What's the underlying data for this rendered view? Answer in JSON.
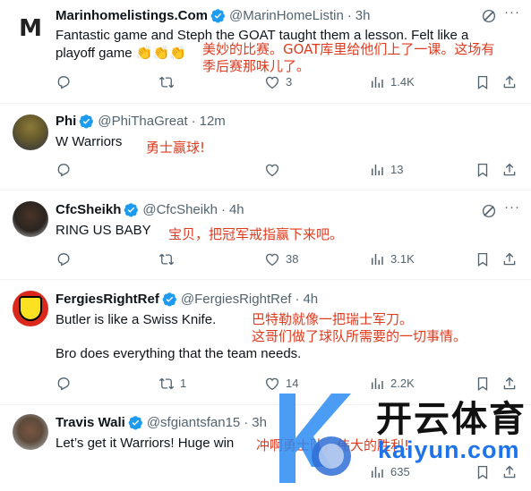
{
  "tweets": [
    {
      "name": "Marinhomelistings.Com",
      "handle": "@MarinHomeListin",
      "time": "3h",
      "body_lines": [
        "Fantastic game and Steph the GOAT taught them a lesson. Felt like a",
        "playoff game 👏👏👏"
      ],
      "annotation_lines": [
        "美妙的比赛。GOAT库里给他们上了一课。这场有",
        "季后赛那味儿了。"
      ],
      "replies": "",
      "retweets": "",
      "likes": "3",
      "views": "1.4K",
      "avatar_letter": "M"
    },
    {
      "name": "Phi",
      "handle": "@PhiThaGreat",
      "time": "12m",
      "body_lines": [
        "W Warriors"
      ],
      "annotation_lines": [
        "勇士赢球!"
      ],
      "replies": "",
      "retweets": "",
      "likes": "",
      "views": "13"
    },
    {
      "name": "CfcSheikh",
      "handle": "@CfcSheikh",
      "time": "4h",
      "body_lines": [
        "RING US BABY"
      ],
      "annotation_lines": [
        "宝贝，把冠军戒指赢下来吧。"
      ],
      "replies": "",
      "retweets": "",
      "likes": "38",
      "views": "3.1K"
    },
    {
      "name": "FergiesRightRef",
      "handle": "@FergiesRightRef",
      "time": "4h",
      "body_lines": [
        "Butler is like a Swiss Knife.",
        "",
        "Bro does everything that the team needs."
      ],
      "annotation_lines": [
        "巴特勒就像一把瑞士军刀。",
        "这哥们做了球队所需要的一切事情。"
      ],
      "replies": "",
      "retweets": "1",
      "likes": "14",
      "views": "2.2K"
    },
    {
      "name": "Travis Wali",
      "handle": "@sfgiantsfan15",
      "time": "3h",
      "body_lines": [
        "Let’s get it Warriors! Huge win"
      ],
      "annotation_lines": [
        "冲啊勇士队，伟大的胜利!"
      ],
      "replies": "",
      "retweets": "",
      "likes": "",
      "views": "635"
    }
  ],
  "watermark": {
    "title": "开云体育",
    "url": "kaiyun.com"
  },
  "colors": {
    "text": "#0f1419",
    "muted": "#536471",
    "verified": "#1d9bf0",
    "annotation": "#e03a1e",
    "divider": "#eff3f4"
  },
  "icons": [
    "verified-badge-icon",
    "grok-icon",
    "more-icon",
    "reply-icon",
    "retweet-icon",
    "like-icon",
    "views-icon",
    "bookmark-icon",
    "share-icon"
  ]
}
